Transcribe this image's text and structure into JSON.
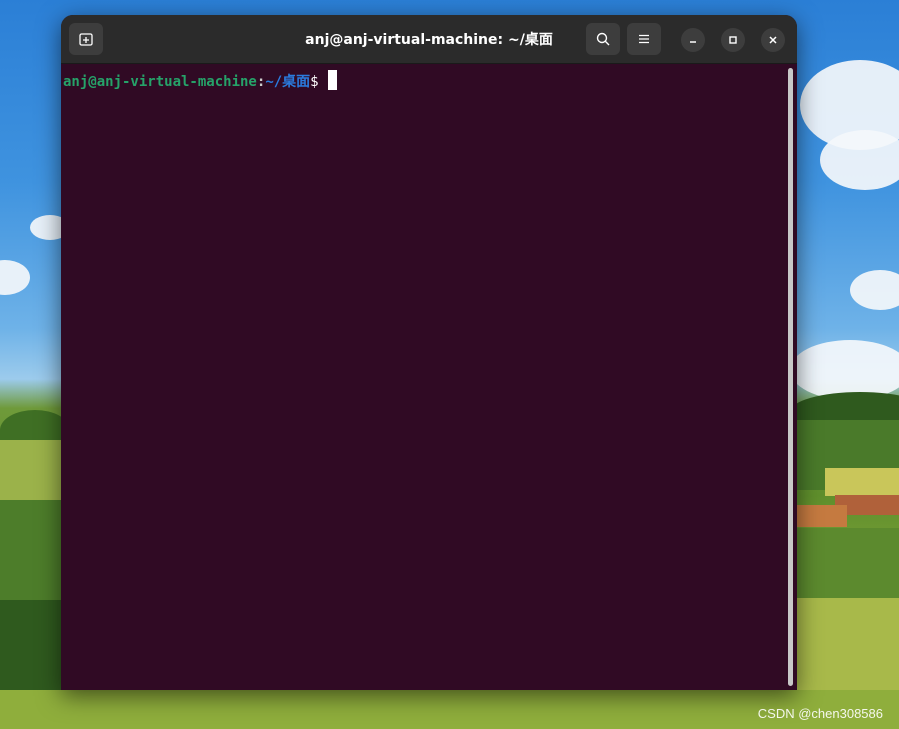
{
  "window": {
    "title": "anj@anj-virtual-machine: ~/桌面"
  },
  "toolbar": {
    "new_tab_icon": "new-tab-icon",
    "search_icon": "search-icon",
    "menu_icon": "hamburger-menu-icon",
    "minimize_icon": "minimize-icon",
    "maximize_icon": "maximize-icon",
    "close_icon": "close-icon"
  },
  "terminal": {
    "user_host": "anj@anj-virtual-machine",
    "colon": ":",
    "path": "~/桌面",
    "dollar": "$",
    "colors": {
      "background": "#300a24",
      "user": "#26a269",
      "path": "#2a7bde"
    }
  },
  "watermark": {
    "text": "CSDN @chen308586"
  }
}
